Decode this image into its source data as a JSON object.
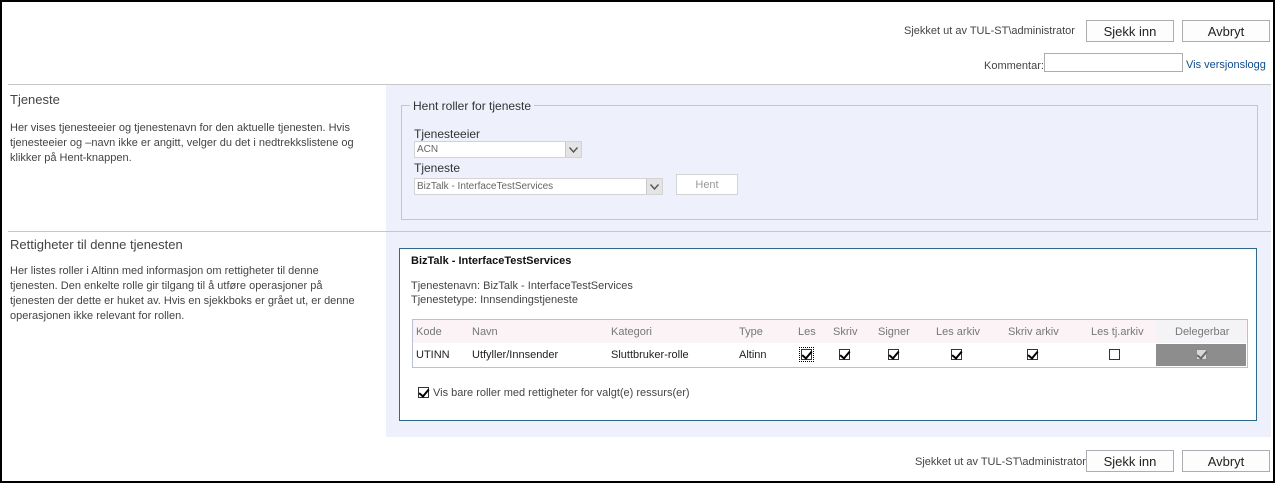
{
  "top_bar": {
    "checked_out_text": "Sjekket ut av TUL-ST\\administrator",
    "check_in_label": "Sjekk inn",
    "cancel_label": "Avbryt",
    "comment_label": "Kommentar:",
    "comment_value": "",
    "version_log_link": "Vis versjonslogg"
  },
  "service_section": {
    "title": "Tjeneste",
    "description": "Her vises tjenesteeier og tjenestenavn for den aktuelle tjenesten. Hvis tjenesteeier og –navn ikke er angitt, velger du det i nedtrekkslistene og klikker på Hent-knappen.",
    "group_legend": "Hent roller for tjeneste",
    "owner_label": "Tjenesteeier",
    "owner_value": "ACN",
    "service_label": "Tjeneste",
    "service_value": "BizTalk - InterfaceTestServices",
    "fetch_label": "Hent"
  },
  "rights_section": {
    "title": "Rettigheter til denne tjenesten",
    "description": "Her listes roller i Altinn med informasjon om rettigheter til denne tjenesten. Den enkelte rolle gir tilgang til å utføre operasjoner på tjenesten der dette er huket av. Hvis en sjekkboks er grået ut, er denne operasjonen ikke relevant for rollen.",
    "box_title": "BizTalk - InterfaceTestServices",
    "service_name_line": "Tjenestenavn: BizTalk - InterfaceTestServices",
    "service_type_line": "Tjenestetype: Innsendingstjeneste",
    "table": {
      "columns": [
        "Kode",
        "Navn",
        "Kategori",
        "Type",
        "Les",
        "Skriv",
        "Signer",
        "Les arkiv",
        "Skriv arkiv",
        "Les tj.arkiv",
        "Delegerbar"
      ],
      "rows": [
        {
          "kode": "UTINN",
          "navn": "Utfyller/Innsender",
          "kategori": "Sluttbruker-rolle",
          "type": "Altinn",
          "les": true,
          "skriv": true,
          "signer": true,
          "les_arkiv": true,
          "skriv_arkiv": true,
          "les_tj_arkiv": false,
          "delegerbar": true
        }
      ]
    },
    "filter_label": "Vis bare roller med rettigheter for valgt(e) ressurs(er)",
    "filter_checked": true
  },
  "bottom_bar": {
    "checked_out_text": "Sjekket ut av TUL-ST\\administrator",
    "check_in_label": "Sjekk inn",
    "cancel_label": "Avbryt"
  },
  "colors": {
    "right_pane_bg": "#eef0fb",
    "box_border": "#2c6a8b",
    "link": "#0e4c8c",
    "delegerbar_bg": "#8d8d8d"
  }
}
